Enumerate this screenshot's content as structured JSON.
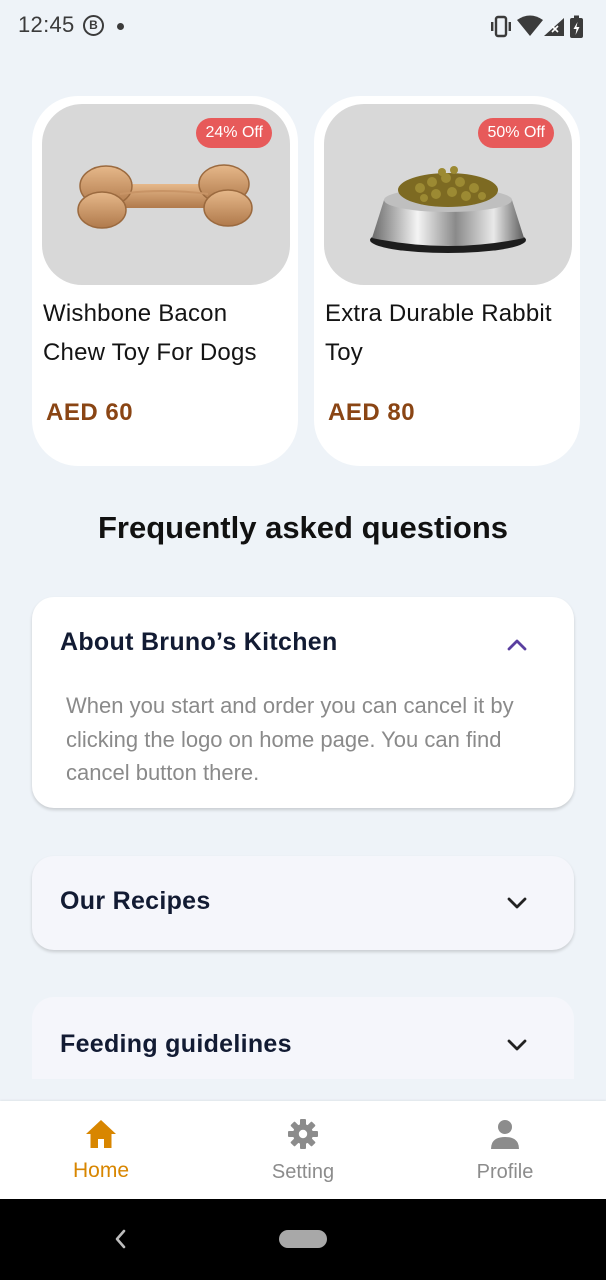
{
  "status_bar": {
    "time": "12:45",
    "indicator_letter": "B"
  },
  "products": [
    {
      "discount": "24% Off",
      "title": "Wishbone Bacon Chew Toy For Dogs",
      "price": "AED 60",
      "image": "bone-chew-toy"
    },
    {
      "discount": "50% Off",
      "title": "Extra Durable Rabbit Toy",
      "price": "AED 80",
      "image": "steel-bowl-with-kibble"
    }
  ],
  "faq": {
    "heading": "Frequently asked questions",
    "items": [
      {
        "question": "About Bruno’s Kitchen",
        "answer": "When you start and order you can cancel it by clicking the logo on home page. You can find cancel button there.",
        "expanded": true
      },
      {
        "question": "Our Recipes",
        "expanded": false
      },
      {
        "question": "Feeding guidelines",
        "expanded": false
      }
    ]
  },
  "bottom_nav": {
    "items": [
      {
        "label": "Home",
        "icon": "home-icon",
        "active": true
      },
      {
        "label": "Setting",
        "icon": "gear-icon",
        "active": false
      },
      {
        "label": "Profile",
        "icon": "person-icon",
        "active": false
      }
    ]
  },
  "colors": {
    "page_background": "#eef3f8",
    "badge": "#e75a5a",
    "price": "#8a4514",
    "active_nav": "#d88600",
    "chevron_open": "#5a3fa0",
    "faq_question": "#121b33"
  }
}
